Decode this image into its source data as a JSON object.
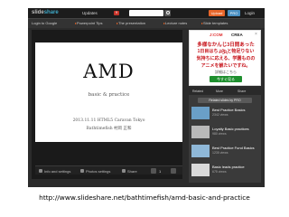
{
  "topbar": {
    "logo_prefix": "slide",
    "logo_suffix": "share",
    "nav_updates": "Updates",
    "nav_badge": "9",
    "nav_explore": "Explore",
    "upload_label": "Upload",
    "pro_label": "PRO",
    "login_label": "Login"
  },
  "subbar": {
    "login_google": "Login to Google",
    "items": [
      "Powerpoint Tips",
      "The presentation",
      "Lecture notes",
      "Slide templates"
    ]
  },
  "slide": {
    "title": "AMD",
    "subtitle": "basic & practice",
    "event": "2013.11.11 HTML5 Caravan Tokyo",
    "author": "Bathtimefish 村岡 正和"
  },
  "controls": {
    "info_label": "Info and settings",
    "settings_label": "Photos settings",
    "share_label": "Share",
    "page_indicator": "1"
  },
  "ad": {
    "brand_left": "J:COM",
    "brand_right": "CREA",
    "line1": "多様なかんじ3日間あったら、",
    "line2": "1日目はちょっと物足りない",
    "line3": "気持ちに応える、学園ものの",
    "line4": "アニメを観たいですね。",
    "cta_small": "詳細はこちら",
    "cta": "今すぐ見る"
  },
  "related": {
    "tabs": [
      "Related",
      "More",
      "Share"
    ],
    "featured_label": "Related slides by PRO",
    "items": [
      {
        "title": "Best Practice Basics",
        "views": "2342 views"
      },
      {
        "title": "Loyalty Basic practices",
        "views": "980 views"
      },
      {
        "title": "Best Practice Fund Basics",
        "views": "1235 views"
      },
      {
        "title": "Basic leads practice",
        "views": "675 views"
      }
    ]
  },
  "caption": {
    "url": "http://www.slideshare.net/bathtimefish/amd-basic-and-practice"
  },
  "colors": {
    "accent": "#e8662a",
    "dark": "#2b2b2b",
    "ad_red": "#c7141b"
  }
}
